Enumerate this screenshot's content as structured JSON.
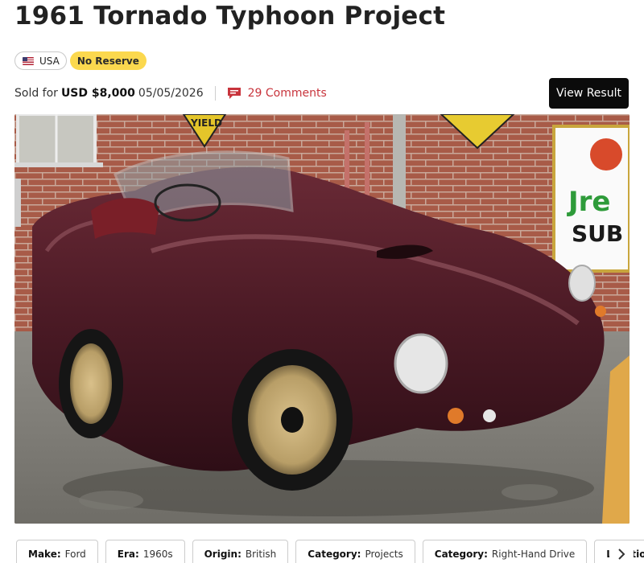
{
  "listing": {
    "title": "1961 Tornado Typhoon Project",
    "country_badge": "USA",
    "country_flag_icon": "us-flag-icon",
    "reserve_badge": "No Reserve",
    "sold_prefix": "Sold for",
    "sold_price": "USD $8,000",
    "sold_date": "05/05/2026",
    "comments_label": "29 Comments",
    "comments_icon": "comment-bubble-icon",
    "view_result_label": "View Result"
  },
  "photo": {
    "alt": "Maroon 1961 Tornado Typhoon roadster parked in front of a brick wall"
  },
  "signs": {
    "yield": "YIELD",
    "store_logo_1": "Jre",
    "store_logo_2": "SUB"
  },
  "details": [
    {
      "label": "Make:",
      "value": "Ford"
    },
    {
      "label": "Era:",
      "value": "1960s"
    },
    {
      "label": "Origin:",
      "value": "British"
    },
    {
      "label": "Category:",
      "value": "Projects"
    },
    {
      "label": "Category:",
      "value": "Right-Hand Drive"
    },
    {
      "label": "Location:",
      "value": ""
    }
  ],
  "colors": {
    "comments_accent": "#c8343c",
    "reserve_badge_bg": "#fbd84e",
    "button_bg": "#0b0b0b"
  }
}
